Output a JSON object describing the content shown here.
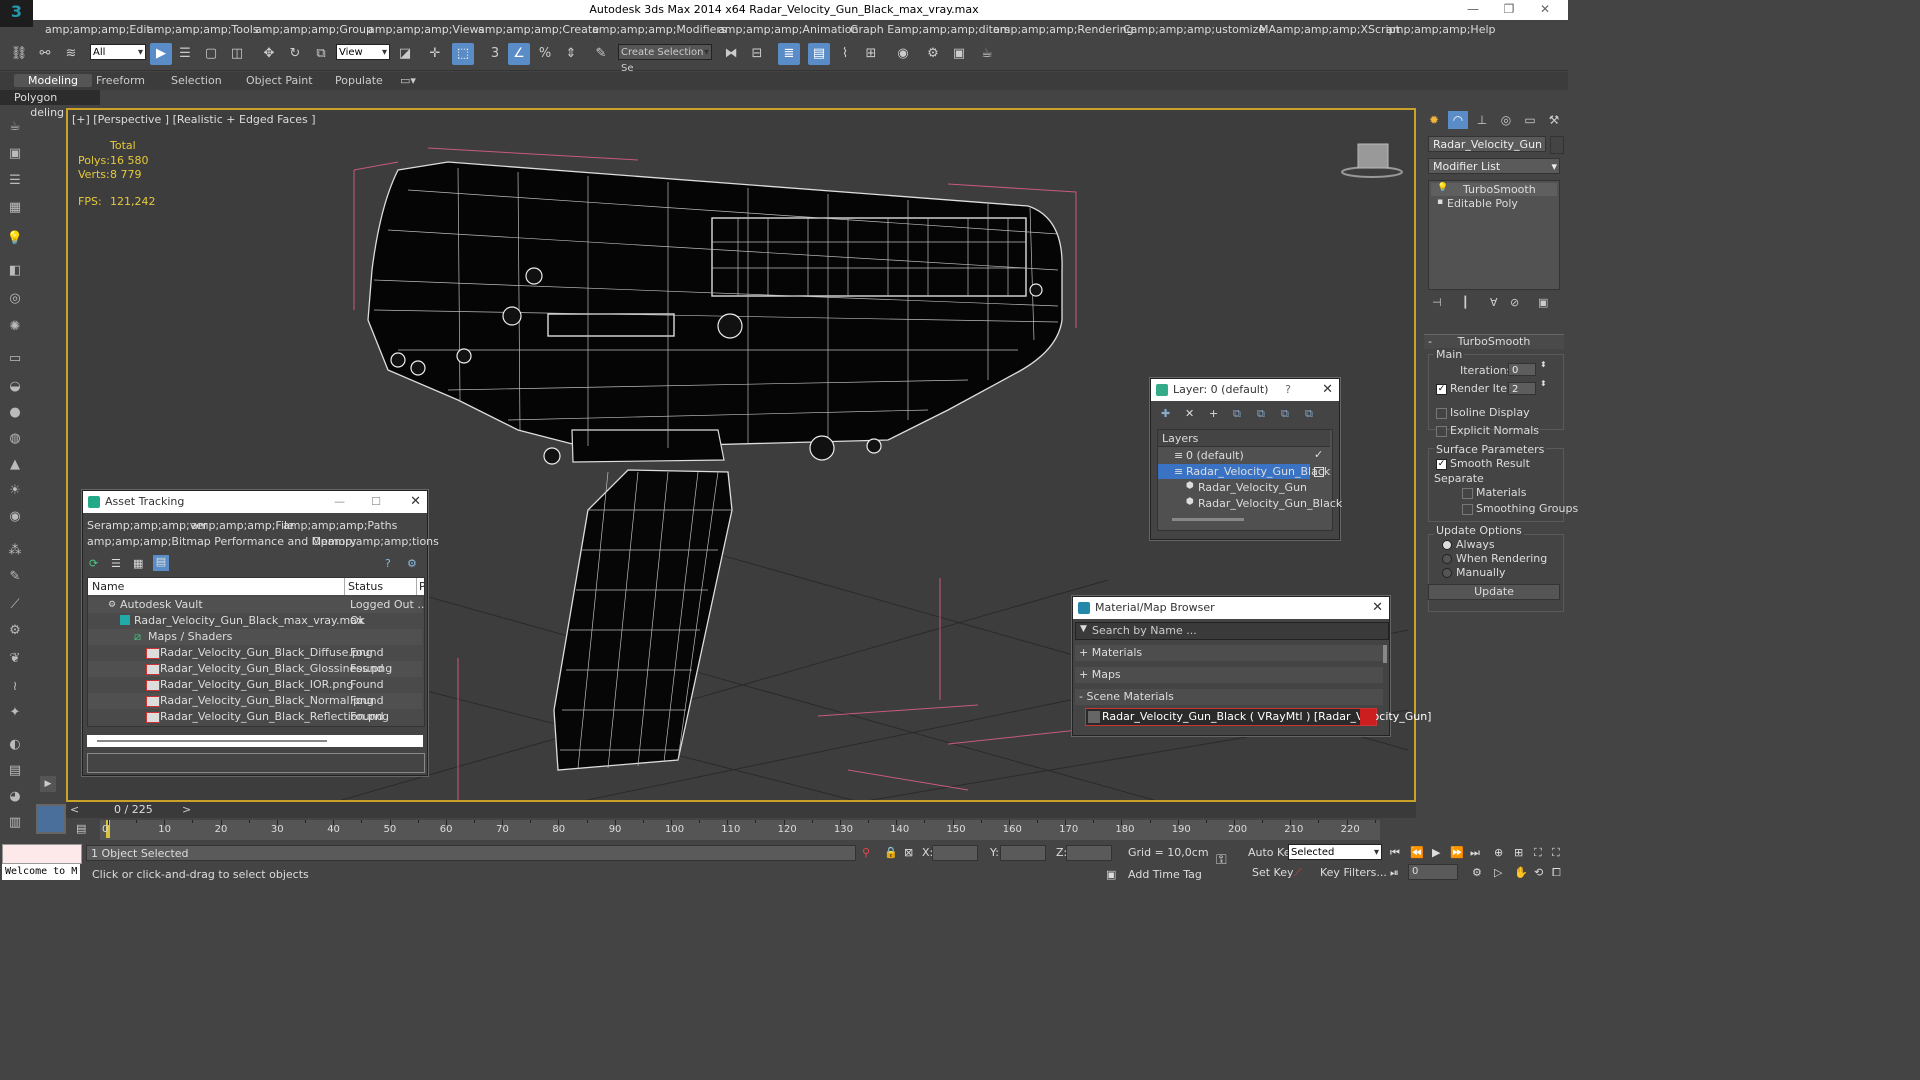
{
  "app": {
    "title": "Autodesk 3ds Max  2014 x64     Radar_Velocity_Gun_Black_max_vray.max",
    "logo": "3"
  },
  "menu": [
    "amp;amp;amp;Edit",
    "amp;amp;amp;Tools",
    "amp;amp;amp;Group",
    "amp;amp;amp;Views",
    "amp;amp;amp;Create",
    "amp;amp;amp;Modifiers",
    "amp;amp;amp;Animation",
    "Graph Eamp;amp;amp;ditors",
    "amp;amp;amp;Rendering",
    "Camp;amp;amp;ustomize",
    "MAamp;amp;amp;XScript",
    "amp;amp;amp;Help"
  ],
  "toolbar": {
    "filter_value": "All",
    "ref_coord_value": "View",
    "selection_set_placeholder": "Create Selection Se"
  },
  "ribbon": {
    "tabs": [
      "Modeling",
      "Freeform",
      "Selection",
      "Object Paint",
      "Populate"
    ],
    "sub_label": "Polygon Modeling"
  },
  "viewport": {
    "label": "[+] [Perspective ] [Realistic + Edged Faces ]",
    "stats_header": "Total",
    "polys_label": "Polys:",
    "polys_value": "16 580",
    "verts_label": "Verts:",
    "verts_value": "8 779",
    "fps_label": "FPS:",
    "fps_value": "121,242"
  },
  "command_panel": {
    "object_name": "Radar_Velocity_Gun",
    "modifier_list_label": "Modifier List",
    "stack": [
      "TurboSmooth",
      "Editable Poly"
    ],
    "rollout_title": "TurboSmooth",
    "main_group": "Main",
    "iterations_label": "Iterations:",
    "iterations_value": "0",
    "render_iters_label": "Render Iters:",
    "render_iters_value": "2",
    "isoline_label": "Isoline Display",
    "explicit_normals_label": "Explicit Normals",
    "surface_params_label": "Surface Parameters",
    "smooth_result_label": "Smooth Result",
    "separate_label": "Separate",
    "materials_label": "Materials",
    "smoothing_groups_label": "Smoothing Groups",
    "update_options_label": "Update Options",
    "always_label": "Always",
    "when_rendering_label": "When Rendering",
    "manually_label": "Manually",
    "update_button": "Update"
  },
  "layer_dialog": {
    "title": "Layer: 0 (default)",
    "help": "?",
    "header": "Layers",
    "items": [
      "0 (default)",
      "Radar_Velocity_Gun_Black",
      "Radar_Velocity_Gun",
      "Radar_Velocity_Gun_Black"
    ]
  },
  "asset_tracking": {
    "title": "Asset Tracking",
    "menu": [
      "Seramp;amp;amp;ver",
      "amp;amp;amp;File",
      "amp;amp;amp;Paths",
      "amp;amp;amp;Bitmap Performance and Memory",
      "Opamp;amp;amp;tions"
    ],
    "col_name": "Name",
    "col_status": "Status",
    "col_p": "P",
    "rows": [
      {
        "name": "Autodesk Vault",
        "status": "Logged Out ..."
      },
      {
        "name": "Radar_Velocity_Gun_Black_max_vray.max",
        "status": "Ok"
      },
      {
        "name": "Maps / Shaders",
        "status": ""
      },
      {
        "name": "Radar_Velocity_Gun_Black_Diffuse.png",
        "status": "Found"
      },
      {
        "name": "Radar_Velocity_Gun_Black_Glossiness.png",
        "status": "Found"
      },
      {
        "name": "Radar_Velocity_Gun_Black_IOR.png",
        "status": "Found"
      },
      {
        "name": "Radar_Velocity_Gun_Black_Normal.png",
        "status": "Found"
      },
      {
        "name": "Radar_Velocity_Gun_Black_Reflection.png",
        "status": "Found"
      }
    ]
  },
  "material_browser": {
    "title": "Material/Map Browser",
    "search_placeholder": "Search by Name ...",
    "groups": [
      "+ Materials",
      "+ Maps",
      "- Scene Materials"
    ],
    "scene_material": "Radar_Velocity_Gun_Black  ( VRayMtl )  [Radar_Velocity_Gun]"
  },
  "timeline": {
    "frame_label": "0 / 225",
    "ticks": [
      "0",
      "10",
      "20",
      "30",
      "40",
      "50",
      "60",
      "70",
      "80",
      "90",
      "100",
      "110",
      "120",
      "130",
      "140",
      "150",
      "160",
      "170",
      "180",
      "190",
      "200",
      "210",
      "220"
    ]
  },
  "status": {
    "objects_selected": "1 Object Selected",
    "prompt": "Click or click-and-drag to select objects",
    "welcome": "Welcome to M",
    "x_label": "X:",
    "y_label": "Y:",
    "z_label": "Z:",
    "grid": "Grid = 10,0cm",
    "add_time_tag": "Add Time Tag",
    "auto_key": "Auto Key",
    "set_key": "Set Key",
    "selected_value": "Selected",
    "key_filters": "Key Filters...",
    "frame_value": "0"
  },
  "colors": {
    "accent": "#5a8dc8",
    "viewport_border": "#c9a227",
    "stats_yellow": "#e6c93c",
    "selection_blue": "#3b73c4",
    "material_swatch": "#cc1e1e"
  }
}
